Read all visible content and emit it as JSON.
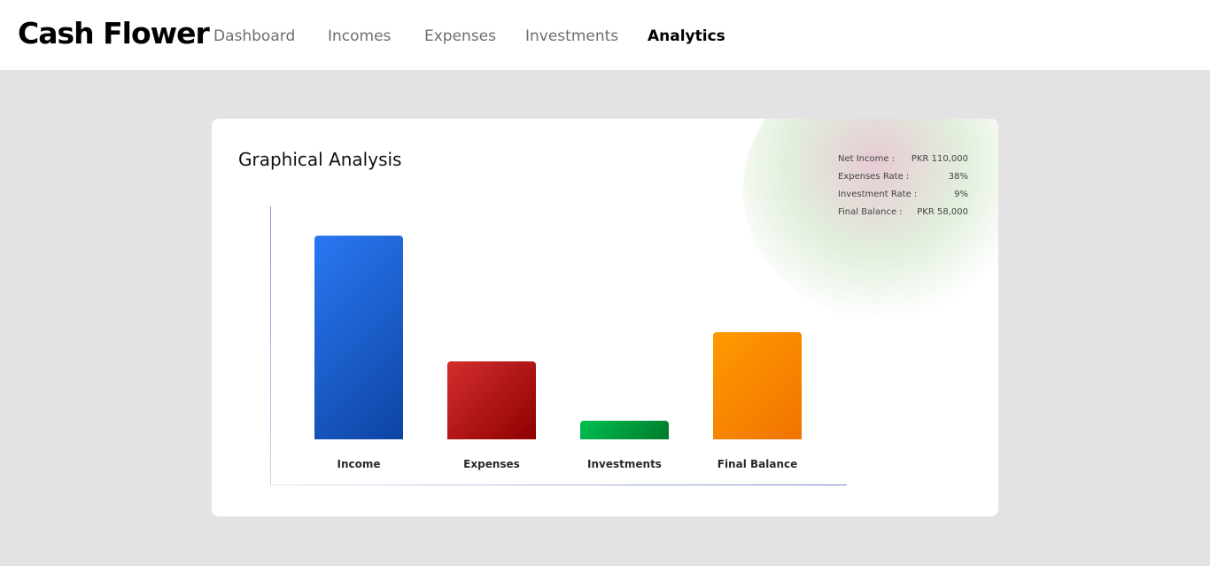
{
  "app": {
    "title": "Cash Flower"
  },
  "nav": {
    "items": [
      {
        "label": "Dashboard",
        "active": false
      },
      {
        "label": "Incomes",
        "active": false
      },
      {
        "label": "Expenses",
        "active": false
      },
      {
        "label": "Investments",
        "active": false
      },
      {
        "label": "Analytics",
        "active": true
      }
    ]
  },
  "card": {
    "title": "Graphical Analysis"
  },
  "summary": {
    "net_income_label": "Net Income :",
    "net_income_value": "PKR 110,000",
    "expenses_rate_label": "Expenses Rate :",
    "expenses_rate_value": "38%",
    "investment_rate_label": "Investment Rate :",
    "investment_rate_value": "9%",
    "final_balance_label": "Final Balance :",
    "final_balance_value": "PKR 58,000"
  },
  "chart_data": {
    "type": "bar",
    "categories": [
      "Income",
      "Expenses",
      "Investments",
      "Final Balance"
    ],
    "values": [
      110000,
      42000,
      10000,
      58000
    ],
    "ylim": [
      0,
      110000
    ],
    "grid": false,
    "colors": [
      [
        "#2a78f2",
        "#0d44a3"
      ],
      [
        "#d42e2e",
        "#8e0000"
      ],
      [
        "#00c050",
        "#007a2c"
      ],
      [
        "#ff9a00",
        "#f07300"
      ]
    ]
  }
}
